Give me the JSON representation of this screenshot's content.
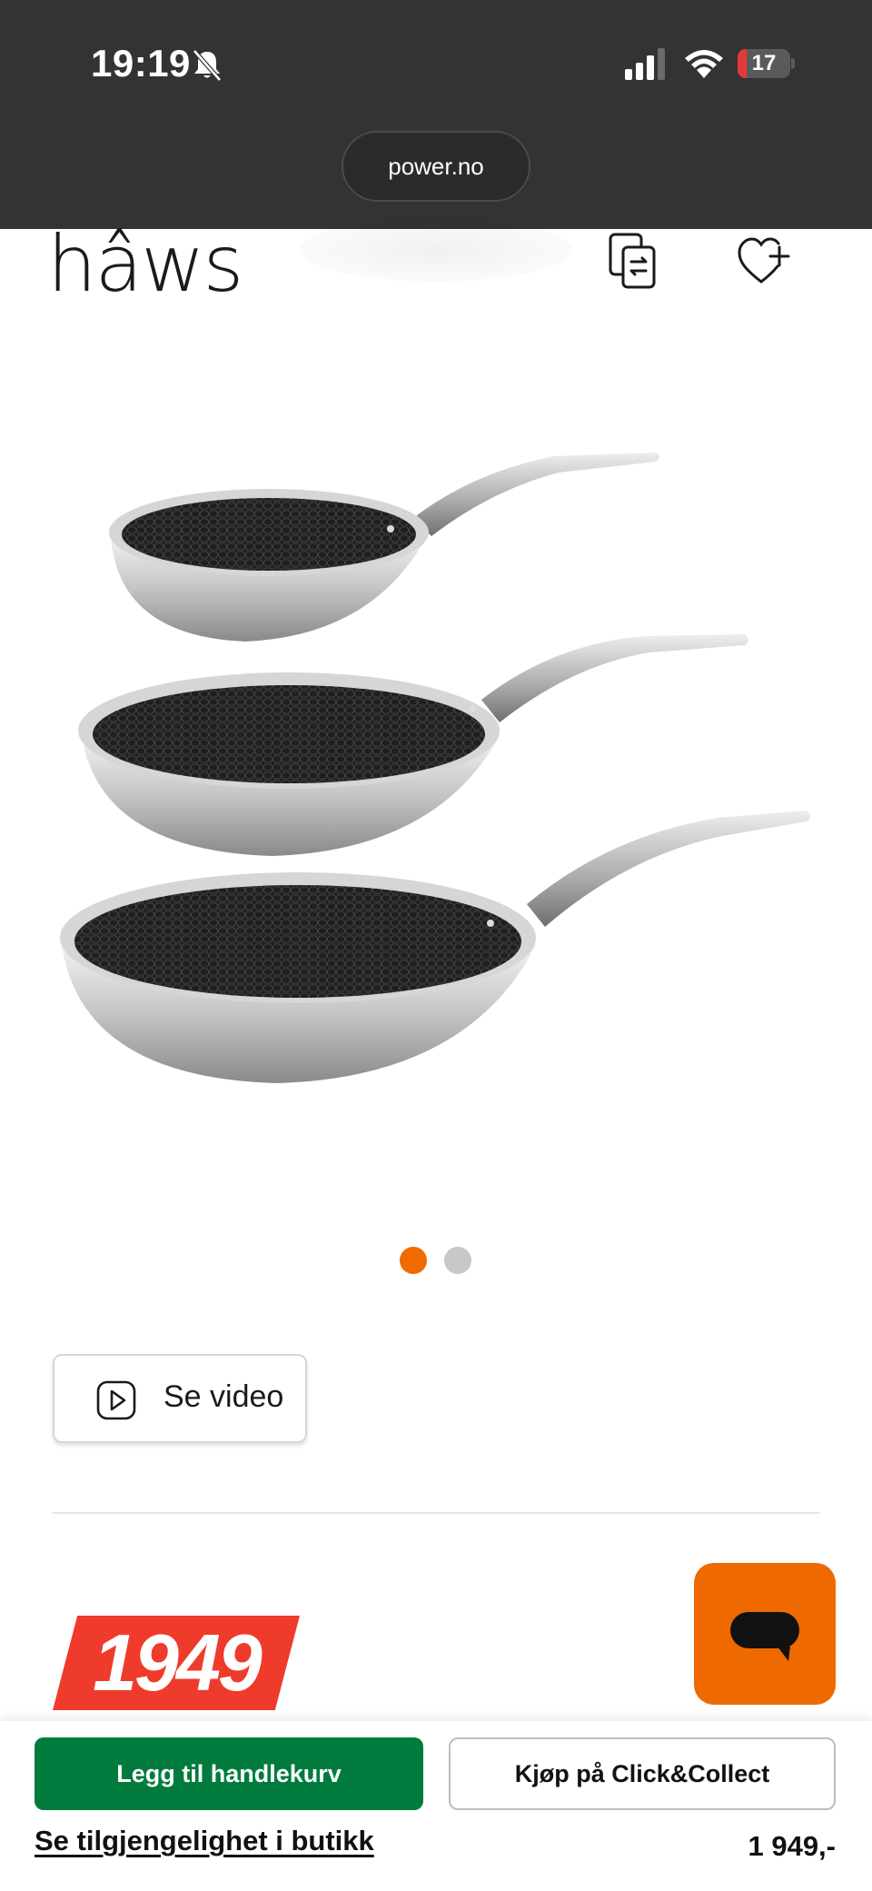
{
  "status_bar": {
    "time": "19:19",
    "battery_level": "17",
    "battery_fraction": 0.17,
    "battery_color": "#e5393a",
    "icons": [
      "bell-slash-icon",
      "signal-icon",
      "wifi-icon",
      "battery-icon"
    ]
  },
  "browser": {
    "url": "power.no"
  },
  "header": {
    "brand": "hâws",
    "icons": [
      "compare-icon",
      "heart-plus-icon"
    ]
  },
  "carousel": {
    "total_slides": 2,
    "active_slide": 1,
    "active_color": "#ef6a00"
  },
  "video_button": {
    "label": "Se video",
    "icon": "play-icon"
  },
  "price_badge": {
    "value": "1949",
    "color": "#ee3b2b"
  },
  "chat": {
    "icon": "chat-bubble-icon",
    "color": "#ee6a00"
  },
  "bottom_bar": {
    "add_to_cart_label": "Legg til handlekurv",
    "add_to_cart_color": "#007b3d",
    "click_collect_label": "Kjøp på Click&Collect",
    "store_availability_label": "Se tilgjengelighet i butikk",
    "price": "1 949,-"
  }
}
